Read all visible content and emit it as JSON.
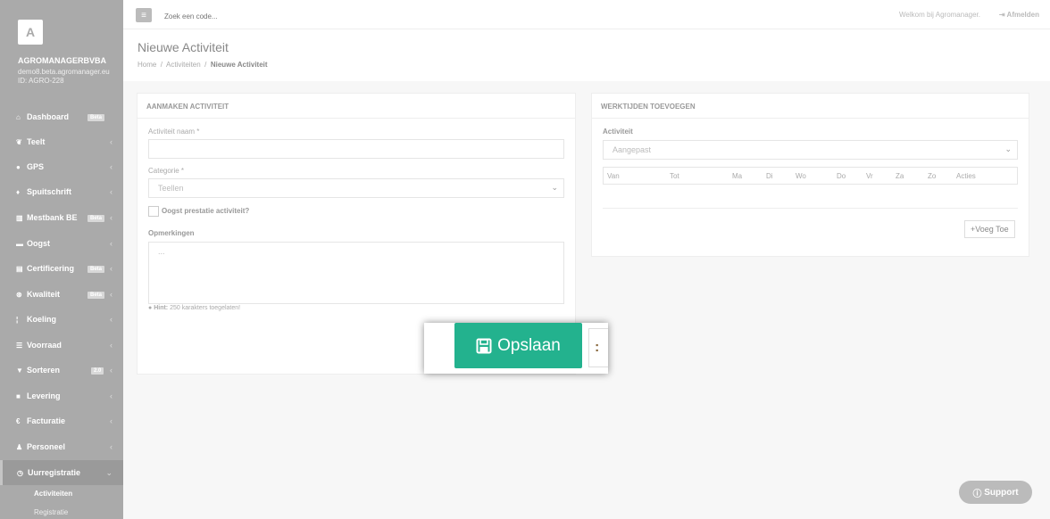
{
  "sidebar": {
    "avatar_letter": "A",
    "company": "AGROMANAGERBVBA",
    "email": "demo8.beta.agromanager.eu",
    "id": "ID: AGRO-228",
    "items": [
      {
        "label": "Dashboard",
        "icon": "home-icon",
        "badge": "Beta"
      },
      {
        "label": "Teelt",
        "icon": "leaf-icon"
      },
      {
        "label": "GPS",
        "icon": "map-marker-icon"
      },
      {
        "label": "Spuitschrift",
        "icon": "drop-icon"
      },
      {
        "label": "Mestbank BE",
        "icon": "bank-icon",
        "badge": "Beta"
      },
      {
        "label": "Oogst",
        "icon": "basket-icon"
      },
      {
        "label": "Certificering",
        "icon": "certificate-icon",
        "badge": "Beta"
      },
      {
        "label": "Kwaliteit",
        "icon": "quality-icon",
        "badge": "Beta"
      },
      {
        "label": "Koeling",
        "icon": "thermometer-icon"
      },
      {
        "label": "Voorraad",
        "icon": "list-icon"
      },
      {
        "label": "Sorteren",
        "icon": "filter-icon",
        "badge": "2.0"
      },
      {
        "label": "Levering",
        "icon": "truck-icon"
      },
      {
        "label": "Facturatie",
        "icon": "euro-icon"
      },
      {
        "label": "Personeel",
        "icon": "user-icon"
      },
      {
        "label": "Uurregistratie",
        "icon": "clock-icon"
      }
    ],
    "sub_items": [
      "Activiteiten",
      "Registratie"
    ]
  },
  "topbar": {
    "search_placeholder": "Zoek een code...",
    "welcome": "Welkom bij Agromanager.",
    "logout": "Afmelden"
  },
  "page": {
    "title": "Nieuwe Activiteit",
    "breadcrumb": [
      "Home",
      "Activiteiten",
      "Nieuwe Activiteit"
    ]
  },
  "form": {
    "heading": "AANMAKEN ACTIVITEIT",
    "name_label": "Activiteit naam *",
    "name_value": "",
    "category_label": "Categorie *",
    "category_value": "Teellen",
    "harvest_label": "Oogst prestatie activiteit?",
    "remarks_label": "Opmerkingen",
    "remarks_placeholder": "...",
    "hint_label": "Hint:",
    "hint_text": "250 karakters toegelaten!"
  },
  "hours": {
    "heading": "WERKTIJDEN TOEVOEGEN",
    "activity_label": "Activiteit",
    "activity_value": "Aangepast",
    "columns": [
      "Van",
      "Tot",
      "Ma",
      "Di",
      "Wo",
      "Do",
      "Vr",
      "Za",
      "Zo",
      "Acties"
    ],
    "add_button": "Voeg Toe"
  },
  "actions": {
    "save": "Opslaan",
    "save_color": "#23b28e"
  },
  "support": "Support"
}
